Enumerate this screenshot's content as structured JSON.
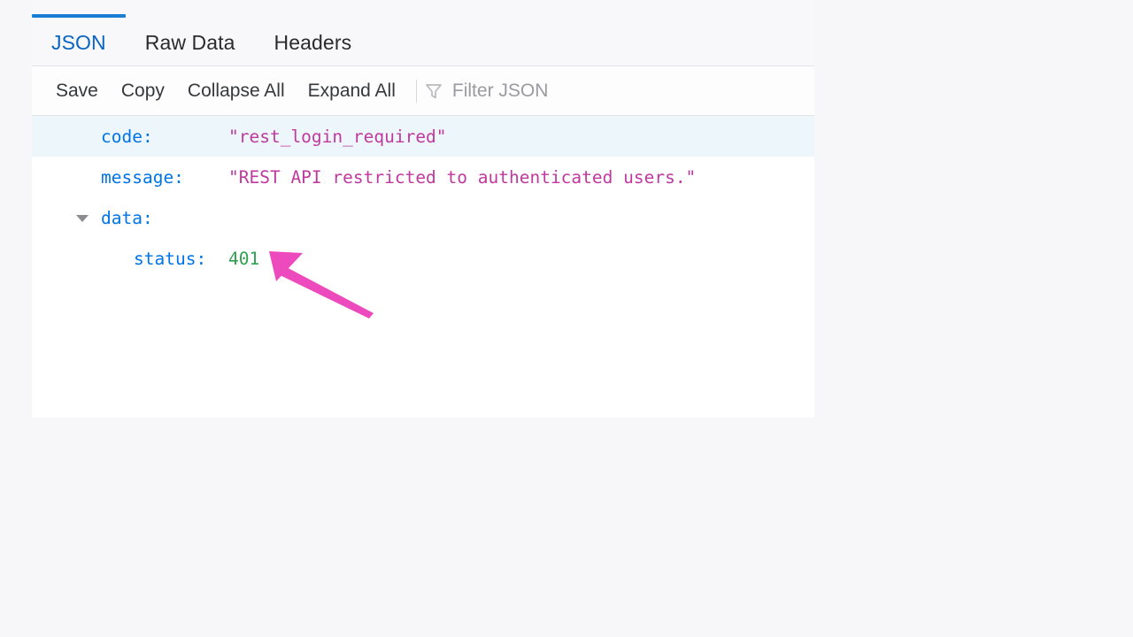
{
  "window": {
    "background_color": "#f7f6f9",
    "panel_background": "#ffffff"
  },
  "tabs": {
    "accent_color": "#1a7fd4",
    "items": [
      {
        "label": "JSON",
        "active": true
      },
      {
        "label": "Raw Data",
        "active": false
      },
      {
        "label": "Headers",
        "active": false
      }
    ]
  },
  "toolbar": {
    "save_label": "Save",
    "copy_label": "Copy",
    "collapse_all_label": "Collapse All",
    "expand_all_label": "Expand All",
    "filter_icon": "funnel-filter-icon",
    "filter_placeholder": "Filter JSON",
    "filter_value": ""
  },
  "json_viewer": {
    "key_color": "#0074e8",
    "string_color": "#c0399f",
    "number_color": "#30a14e",
    "rows": [
      {
        "key": "code:",
        "value": "\"rest_login_required\"",
        "value_type": "string",
        "level": 1,
        "expandable": false,
        "highlighted": true
      },
      {
        "key": "message:",
        "value": "\"REST API restricted to authenticated users.\"",
        "value_type": "string",
        "level": 1,
        "expandable": false,
        "highlighted": false
      },
      {
        "key": "data:",
        "value": "",
        "value_type": "object",
        "level": 1,
        "expandable": true,
        "expanded": true,
        "highlighted": false
      },
      {
        "key": "status:",
        "value": "401",
        "value_type": "number",
        "level": 2,
        "expandable": false,
        "highlighted": false
      }
    ]
  },
  "annotation": {
    "type": "arrow",
    "color": "#ed4bbd",
    "points_at": "401",
    "name": "status-value-callout-arrow"
  }
}
